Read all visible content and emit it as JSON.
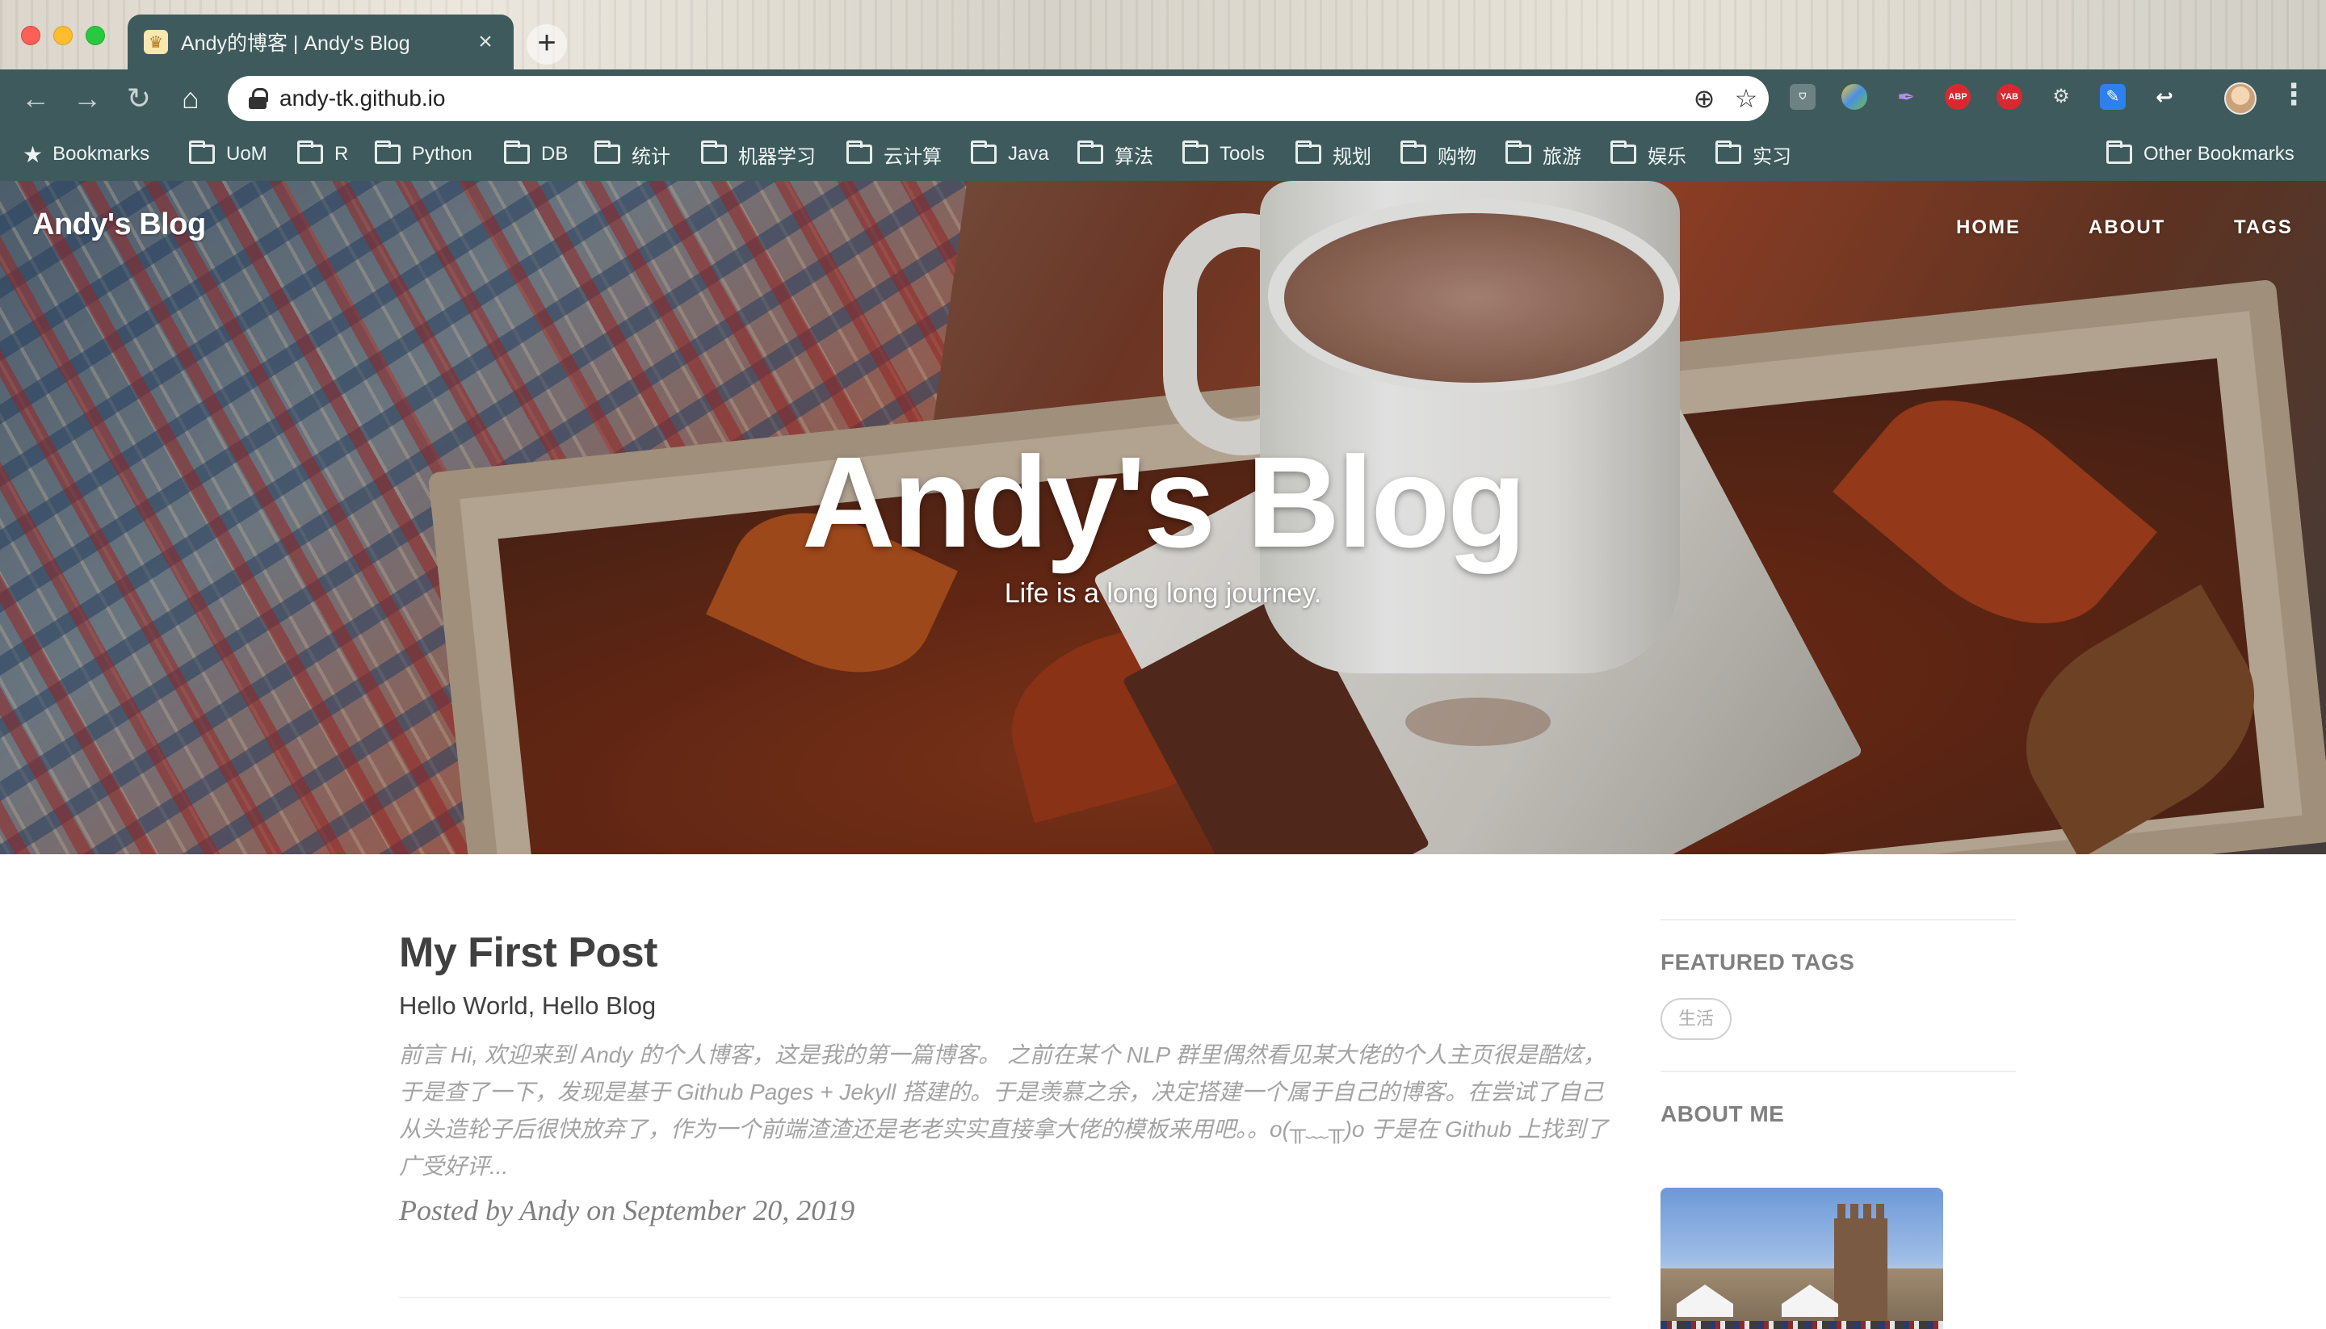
{
  "browser": {
    "tab_title": "Andy的博客 | Andy's Blog",
    "tab_close": "×",
    "new_tab": "+",
    "url": "andy-tk.github.io",
    "bookmarks_label": "Bookmarks",
    "bookmark_folders": [
      "UoM",
      "R",
      "Python",
      "DB",
      "统计",
      "机器学习",
      "云计算",
      "Java",
      "算法",
      "Tools",
      "规划",
      "购物",
      "旅游",
      "娱乐",
      "实习"
    ],
    "other_bookmarks": "Other Bookmarks",
    "extensions": [
      {
        "name": "ABP",
        "color": "#d9282f"
      },
      {
        "name": "YAB",
        "color": "#d9282f"
      }
    ]
  },
  "site": {
    "brand": "Andy's Blog",
    "nav": [
      "HOME",
      "ABOUT",
      "TAGS"
    ],
    "hero_title": "Andy's Blog",
    "hero_subtitle": "Life is a long long journey."
  },
  "post": {
    "title": "My First Post",
    "subtitle": "Hello World, Hello Blog",
    "excerpt": "前言 Hi, 欢迎来到 Andy 的个人博客，这是我的第一篇博客。 之前在某个 NLP 群里偶然看见某大佬的个人主页很是酷炫，于是查了一下，发现是基于 Github Pages + Jekyll 搭建的。于是羡慕之余，决定搭建一个属于自己的博客。在尝试了自己从头造轮子后很快放弃了，作为一个前端渣渣还是老老实实直接拿大佬的模板来用吧。。o(╥﹏╥)o 于是在 Github 上找到了广受好评...",
    "meta": "Posted by Andy on September 20, 2019"
  },
  "sidebar": {
    "featured_tags_heading": "FEATURED TAGS",
    "tags": [
      "生活"
    ],
    "about_heading": "ABOUT ME"
  }
}
